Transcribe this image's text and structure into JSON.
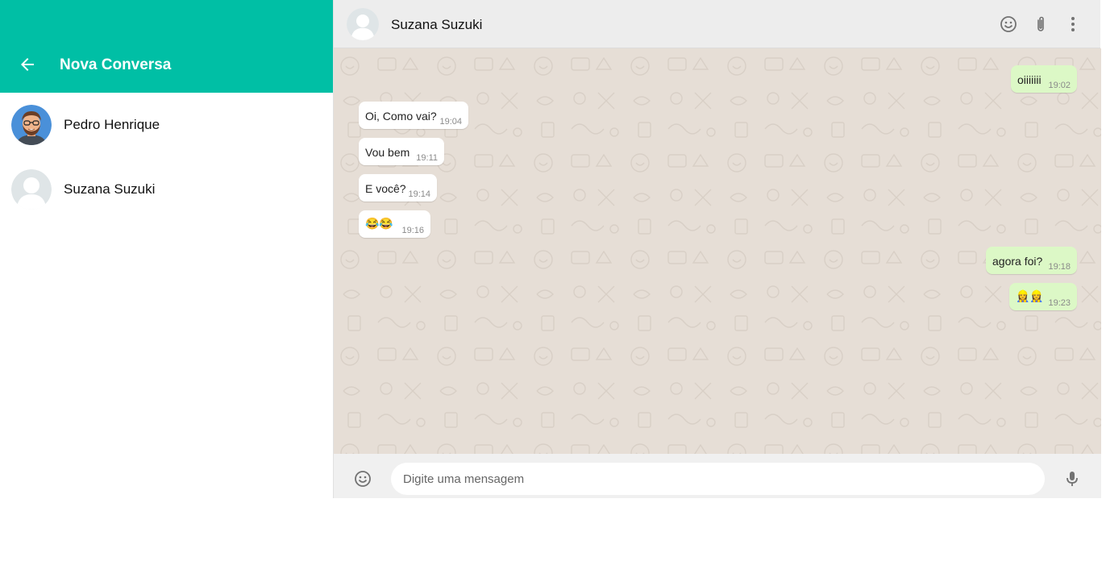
{
  "sidebar": {
    "title": "Nova Conversa",
    "contacts": [
      {
        "name": "Pedro Henrique",
        "avatar": "bearded-man-avatar"
      },
      {
        "name": "Suzana Suzuki",
        "avatar": "default-user-avatar"
      }
    ]
  },
  "chat": {
    "contact_name": "Suzana Suzuki",
    "contact_avatar": "default-user-avatar",
    "header_icons": [
      "smiley-icon",
      "paperclip-icon",
      "more-vertical-icon"
    ],
    "messages": [
      {
        "direction": "out",
        "text": "oiiiiiii",
        "time": "19:02"
      },
      {
        "direction": "in",
        "text": "Oi, Como vai?",
        "time": "19:04"
      },
      {
        "direction": "in",
        "text": "Vou bem",
        "time": "19:11"
      },
      {
        "direction": "in",
        "text": "E você?",
        "time": "19:14"
      },
      {
        "direction": "in",
        "text": "😂😂",
        "time": "19:16"
      },
      {
        "direction": "out",
        "text": "agora foi?",
        "time": "19:18"
      },
      {
        "direction": "out",
        "text": "👷‍♀️👷‍♀️",
        "time": "19:23"
      }
    ]
  },
  "composer": {
    "placeholder": "Digite uma mensagem",
    "value": ""
  },
  "colors": {
    "accent": "#00bfa5",
    "outgoing_bubble": "#dcf8c6",
    "incoming_bubble": "#ffffff",
    "chat_background": "#e6ded6",
    "header_background": "#ededed"
  }
}
